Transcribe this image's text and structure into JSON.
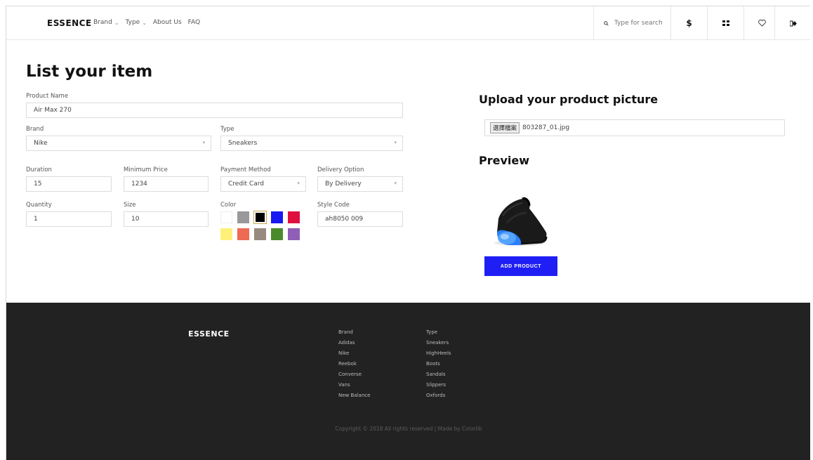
{
  "nav": {
    "logo": "ESSENCE",
    "menu": [
      {
        "label": "Brand",
        "dropdown": true
      },
      {
        "label": "Type",
        "dropdown": true
      },
      {
        "label": "About Us",
        "dropdown": false
      },
      {
        "label": "FAQ",
        "dropdown": false
      }
    ],
    "search_placeholder": "Type for search",
    "icons": [
      "search-icon",
      "dollar-icon",
      "grid-icon",
      "heart-icon",
      "logout-icon"
    ],
    "dollar_glyph": "$"
  },
  "form": {
    "title": "List your item",
    "product_name": {
      "label": "Product Name",
      "value": "Air Max 270"
    },
    "brand": {
      "label": "Brand",
      "value": "Nike"
    },
    "type": {
      "label": "Type",
      "value": "Sneakers"
    },
    "duration": {
      "label": "Duration",
      "value": "15"
    },
    "min_price": {
      "label": "Minimum Price",
      "value": "1234"
    },
    "payment": {
      "label": "Payment Method",
      "value": "Credit Card"
    },
    "delivery": {
      "label": "Delivery Option",
      "value": "By Delivery"
    },
    "quantity": {
      "label": "Quantity",
      "value": "1"
    },
    "size": {
      "label": "Size",
      "value": "10"
    },
    "color": {
      "label": "Color",
      "swatches": [
        "#ffffff",
        "#999999",
        "#000000",
        "#1818f0",
        "#e0103e",
        "#fff07a",
        "#ee6a52",
        "#978a7e",
        "#4a8a2c",
        "#8f5fb5"
      ],
      "selected_index": 2
    },
    "style_code": {
      "label": "Style Code",
      "value": "ah8050 009"
    }
  },
  "upload": {
    "title": "Upload your product picture",
    "button_label": "選擇檔案",
    "filename": "803287_01.jpg",
    "preview_title": "Preview",
    "add_button": "ADD PRODUCT"
  },
  "footer": {
    "logo": "ESSENCE",
    "brand_col": [
      "Brand",
      "Adidas",
      "Nike",
      "Reebok",
      "Converse",
      "Vans",
      "New Balance"
    ],
    "type_col": [
      "Type",
      "Sneakers",
      "HighHeels",
      "Boots",
      "Sandals",
      "Slippers",
      "Oxfords"
    ],
    "copyright": "Copyright © 2018 All rights reserved | Made by Colorlib"
  },
  "colors": {
    "accent": "#1f1ff5",
    "footer_bg": "#222222"
  }
}
